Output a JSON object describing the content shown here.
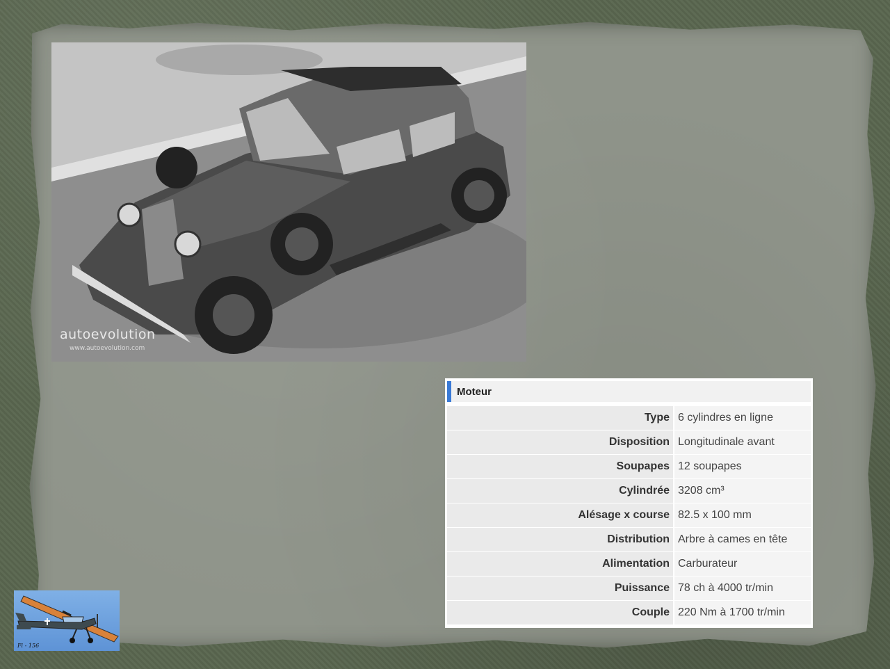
{
  "photo": {
    "watermark": "autoevolution",
    "watermark_url": "www.autoevolution.com"
  },
  "spec_table": {
    "header": "Moteur",
    "accent_color": "#3a7ad6",
    "rows": [
      {
        "label": "Type",
        "value": "6 cylindres en ligne"
      },
      {
        "label": "Disposition",
        "value": "Longitudinale avant"
      },
      {
        "label": "Soupapes",
        "value": "12 soupapes"
      },
      {
        "label": "Cylindrée",
        "value": "3208 cm³"
      },
      {
        "label": "Alésage x course",
        "value": "82.5 x 100 mm"
      },
      {
        "label": "Distribution",
        "value": "Arbre à cames en tête"
      },
      {
        "label": "Alimentation",
        "value": "Carburateur"
      },
      {
        "label": "Puissance",
        "value": "78 ch à 4000 tr/min"
      },
      {
        "label": "Couple",
        "value": "220 Nm à 1700 tr/min"
      }
    ]
  },
  "logo": {
    "caption": "Fi - 156",
    "icon": "airplane-icon"
  }
}
